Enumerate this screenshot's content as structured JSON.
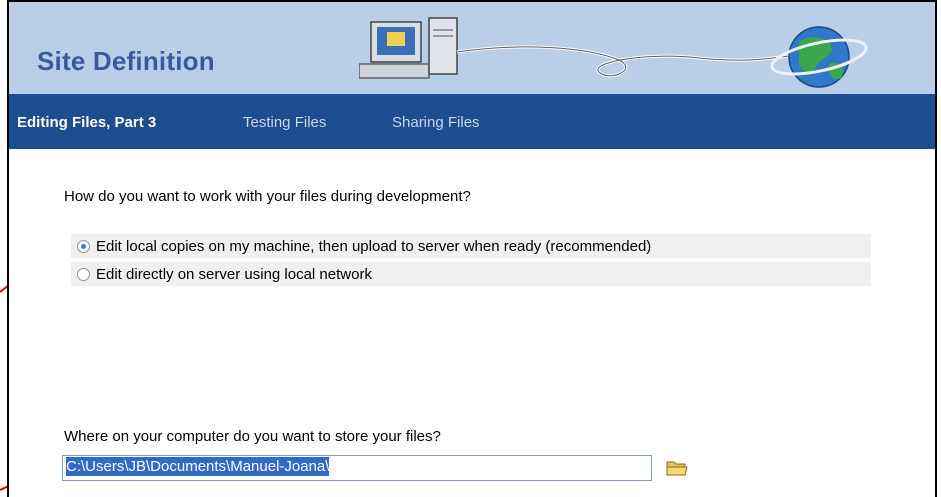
{
  "header": {
    "title": "Site Definition"
  },
  "tabs": [
    {
      "label": "Editing Files, Part 3"
    },
    {
      "label": "Testing Files"
    },
    {
      "label": "Sharing Files"
    }
  ],
  "work_question": "How do you want to work with your files during development?",
  "options": [
    {
      "label": "Edit local copies on my machine, then upload to server when ready (recommended)",
      "checked": true
    },
    {
      "label": "Edit directly on server using local network",
      "checked": false
    }
  ],
  "store_question": "Where on your computer do you want to store your files?",
  "local_path": "C:\\Users\\JB\\Documents\\Manuel-Joana\\",
  "colors": {
    "header": "#b9cfe8",
    "navbar": "#1c4d8f",
    "title": "#3b5a99",
    "arrow": "#e00000"
  }
}
